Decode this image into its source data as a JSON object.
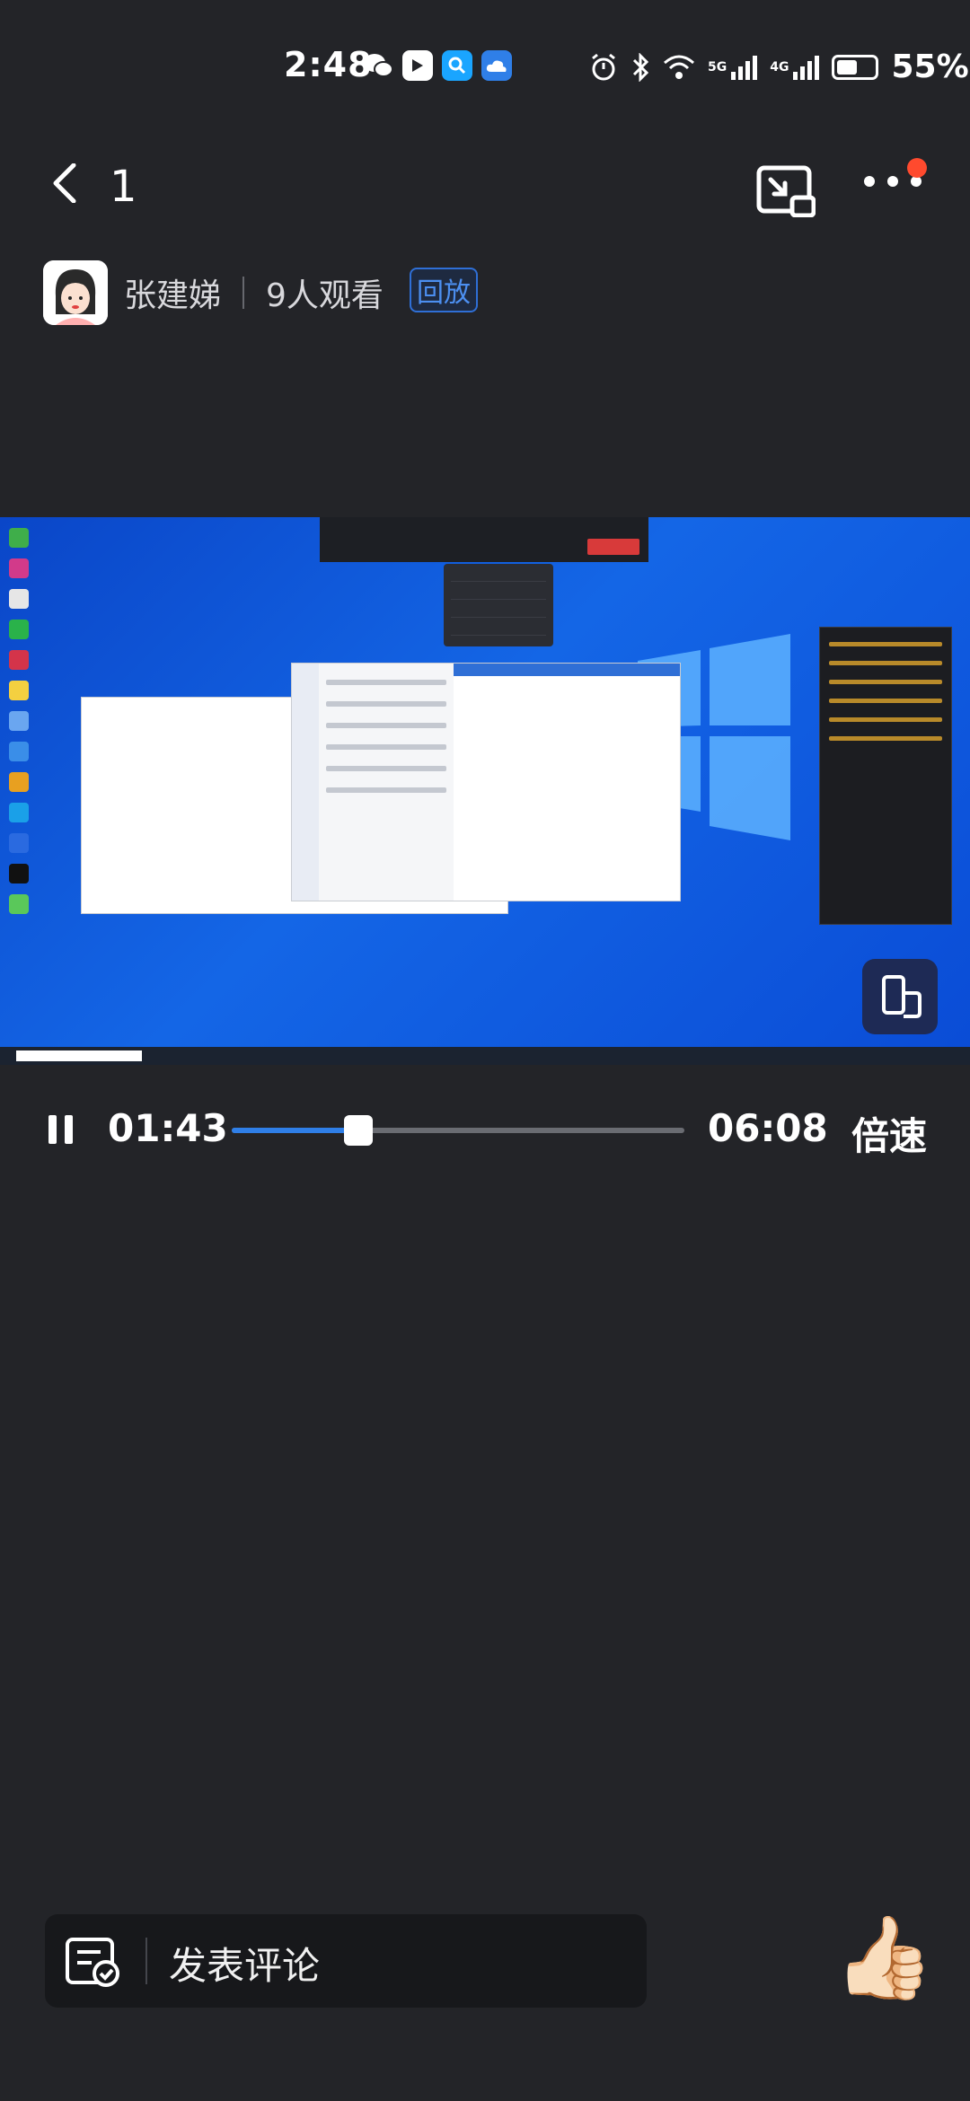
{
  "status_bar": {
    "time": "2:48",
    "network_5g": "5G",
    "network_4g": "4G",
    "battery_percent": "55%",
    "battery_level": 0.55
  },
  "header": {
    "viewer_index": "1",
    "host_name": "张建娣",
    "viewers": "9人观看",
    "replay_badge": "回放"
  },
  "player": {
    "current_time": "01:43",
    "duration": "06:08",
    "speed_label": "倍速",
    "progress": 0.28
  },
  "comment": {
    "placeholder": "发表评论"
  },
  "icons": {
    "back": "back-arrow-icon",
    "pip": "picture-in-picture-icon",
    "more": "more-dots-icon",
    "pause": "pause-icon",
    "comment": "comment-edit-icon",
    "like": "thumbs-up-icon"
  },
  "colors": {
    "background": "#232428",
    "accent": "#2f7fe8",
    "badge_text": "#4c8ff0",
    "notification": "#ff4a2e"
  }
}
